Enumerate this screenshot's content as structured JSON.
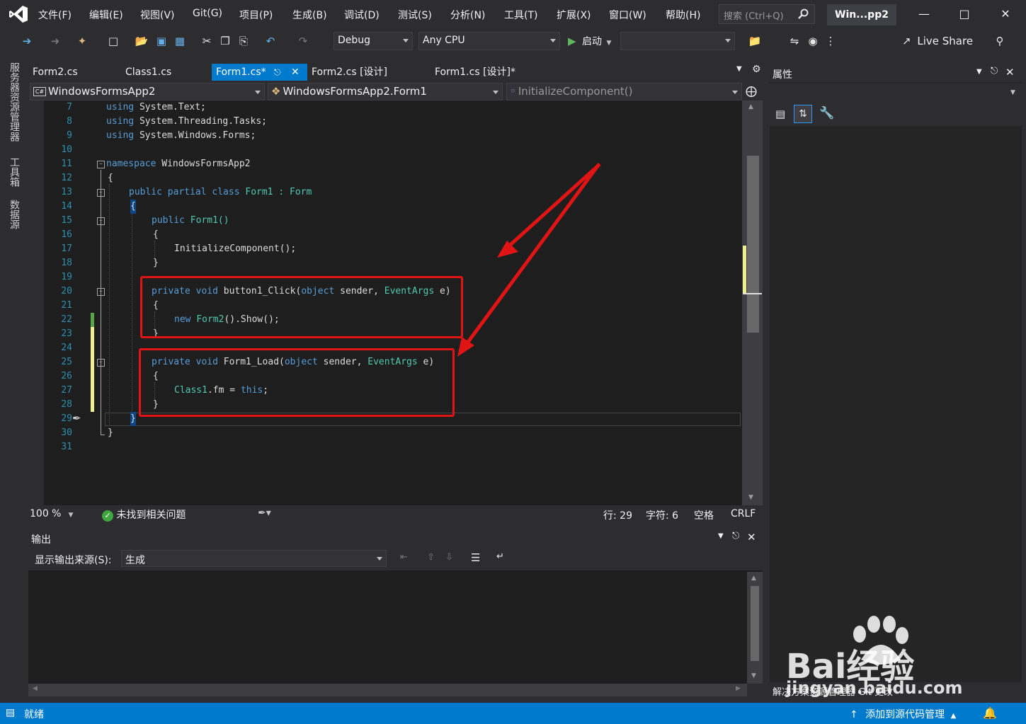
{
  "menubar": {
    "items": [
      "文件(F)",
      "编辑(E)",
      "视图(V)",
      "Git(G)",
      "项目(P)",
      "生成(B)",
      "调试(D)",
      "测试(S)",
      "分析(N)",
      "工具(T)",
      "扩展(X)",
      "窗口(W)",
      "帮助(H)"
    ],
    "search_placeholder": "搜索 (Ctrl+Q)",
    "solution_title": "Win...pp2"
  },
  "toolbar": {
    "config": "Debug",
    "platform": "Any CPU",
    "start_label": "启动",
    "live_share": "Live Share"
  },
  "left_strip": [
    "服务器资源管理器",
    "工具箱",
    "数据源"
  ],
  "doc_tabs": [
    {
      "label": "Form2.cs"
    },
    {
      "label": "Class1.cs"
    },
    {
      "label": "Form1.cs*",
      "active": true
    },
    {
      "label": "Form2.cs [设计]"
    },
    {
      "label": "Form1.cs [设计]*"
    }
  ],
  "navbar": {
    "project": "WindowsFormsApp2",
    "class": "WindowsFormsApp2.Form1",
    "member": "InitializeComponent()"
  },
  "code_lines": [
    {
      "n": "7"
    },
    {
      "n": "8"
    },
    {
      "n": "9"
    },
    {
      "n": "10"
    },
    {
      "n": "11"
    },
    {
      "n": "12"
    },
    {
      "n": "13"
    },
    {
      "n": "14"
    },
    {
      "n": "15"
    },
    {
      "n": "16"
    },
    {
      "n": "17"
    },
    {
      "n": "18"
    },
    {
      "n": "19"
    },
    {
      "n": "20"
    },
    {
      "n": "21"
    },
    {
      "n": "22"
    },
    {
      "n": "23"
    },
    {
      "n": "24"
    },
    {
      "n": "25"
    },
    {
      "n": "26"
    },
    {
      "n": "27"
    },
    {
      "n": "28"
    },
    {
      "n": "29"
    },
    {
      "n": "30"
    },
    {
      "n": "31"
    }
  ],
  "code_text": {
    "l7a": "using",
    "l7b": " System.Text;",
    "l8a": "using",
    "l8b": " System.Threading.Tasks;",
    "l9a": "using",
    "l9b": " System.Windows.Forms;",
    "l11a": "namespace",
    "l11b": " WindowsFormsApp2",
    "l12": "{",
    "l13a": "public partial class",
    "l13b": " Form1 : ",
    "l13c": "Form",
    "l14": "{",
    "l15a": "public",
    "l15b": " Form1()",
    "l16": "{",
    "l17": "InitializeComponent();",
    "l18": "}",
    "l20a": "private void",
    "l20b": " button1_Click(",
    "l20c": "object",
    "l20d": " sender, ",
    "l20e": "EventArgs",
    "l20f": " e)",
    "l21": "{",
    "l22a": "new",
    "l22b": " ",
    "l22c": "Form2",
    "l22d": "().Show();",
    "l23": "}",
    "l25a": "private void",
    "l25b": " Form1_Load(",
    "l25c": "object",
    "l25d": " sender, ",
    "l25e": "EventArgs",
    "l25f": " e)",
    "l26": "{",
    "l27a": "Class1",
    "l27b": ".fm = ",
    "l27c": "this",
    "l27d": ";",
    "l28": "}",
    "l29": "}",
    "l30": "}"
  },
  "editor_status": {
    "zoom": "100 %",
    "issues": "未找到相关问题",
    "line": "行: 29",
    "char": "字符: 6",
    "spaces": "空格",
    "eol": "CRLF"
  },
  "output": {
    "title": "输出",
    "source_label": "显示输出来源(S):",
    "source_value": "生成"
  },
  "properties": {
    "title": "属性",
    "bottom_tabs": "解决方案资源管理器  Git 更改"
  },
  "statusbar": {
    "ready": "就绪",
    "source_control": "添加到源代码管理"
  },
  "watermark": {
    "text": "Bai经验",
    "url": "jingyan.baidu.com"
  },
  "colors": {
    "accent": "#007acc",
    "keyword": "#569cd6",
    "type": "#4ec9b0",
    "linenum": "#2b91af",
    "highlight": "#e01414"
  }
}
